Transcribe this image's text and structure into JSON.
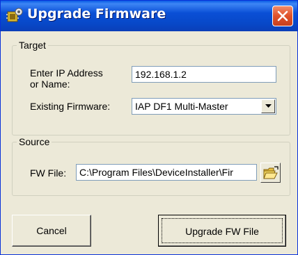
{
  "window": {
    "title": "Upgrade Firmware",
    "app_icon": "firmware-chip-icon",
    "close_icon": "close-icon"
  },
  "target_group": {
    "legend": "Target",
    "ip_label_line1": "Enter IP Address",
    "ip_label_line2": "or Name:",
    "ip_value": "192.168.1.2",
    "firmware_label": "Existing Firmware:",
    "firmware_selected": "IAP DF1 Multi-Master"
  },
  "source_group": {
    "legend": "Source",
    "fw_file_label": "FW File:",
    "fw_file_value": "C:\\Program Files\\DeviceInstaller\\Fir",
    "browse_icon": "open-folder-icon"
  },
  "buttons": {
    "cancel": "Cancel",
    "upgrade": "Upgrade FW File"
  },
  "colors": {
    "titlebar": "#0a4fd6",
    "dialog_bg": "#ece9d8",
    "close_button": "#e0522a"
  }
}
